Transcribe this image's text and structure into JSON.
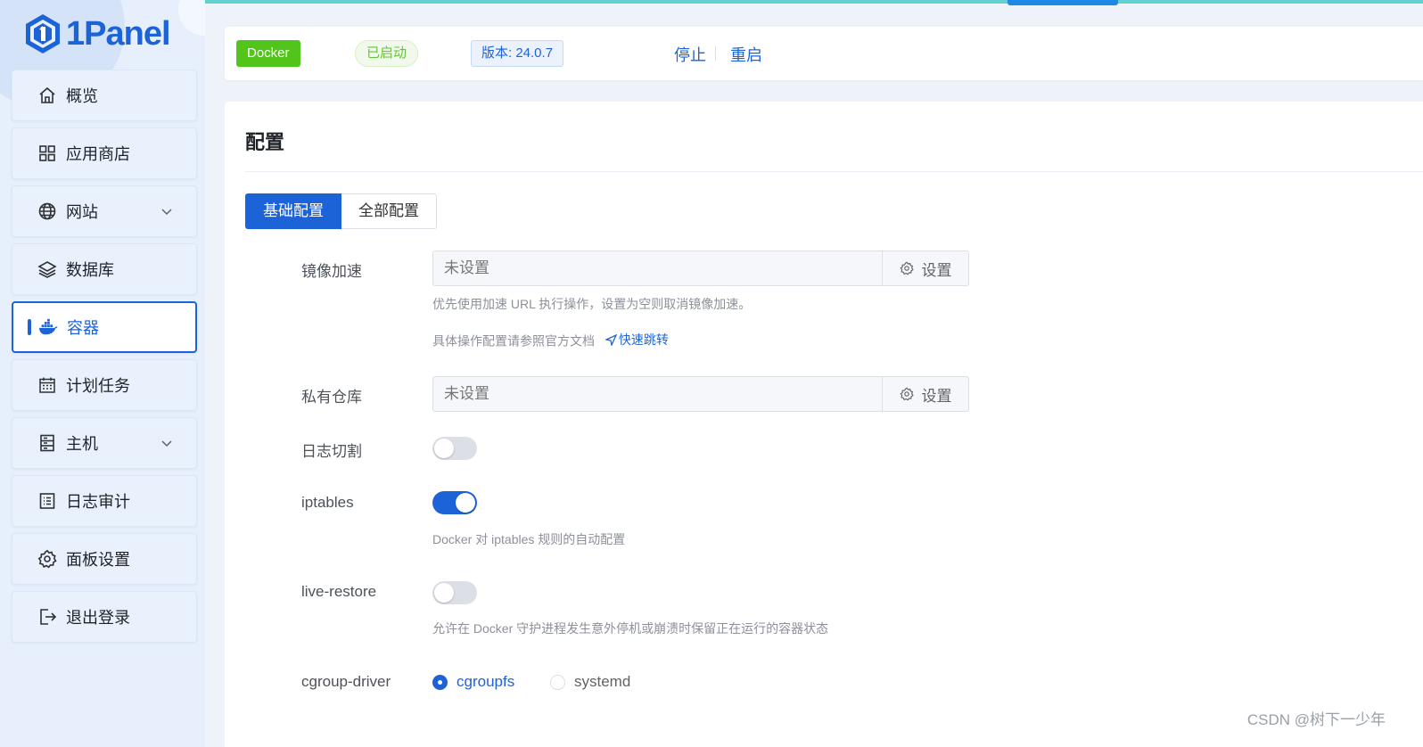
{
  "app": {
    "logo_text": "1Panel"
  },
  "sidebar": {
    "items": [
      {
        "label": "概览",
        "icon": "home-icon"
      },
      {
        "label": "应用商店",
        "icon": "grid-icon"
      },
      {
        "label": "网站",
        "icon": "globe-icon",
        "expandable": true
      },
      {
        "label": "数据库",
        "icon": "layers-icon"
      },
      {
        "label": "容器",
        "icon": "docker-icon",
        "active": true
      },
      {
        "label": "计划任务",
        "icon": "calendar-icon"
      },
      {
        "label": "主机",
        "icon": "server-icon",
        "expandable": true
      },
      {
        "label": "日志审计",
        "icon": "log-icon"
      },
      {
        "label": "面板设置",
        "icon": "gear-icon"
      },
      {
        "label": "退出登录",
        "icon": "logout-icon"
      }
    ]
  },
  "status": {
    "name": "Docker",
    "state": "已启动",
    "version": "版本: 24.0.7",
    "stop_label": "停止",
    "restart_label": "重启"
  },
  "config": {
    "title": "配置",
    "tabs": [
      "基础配置",
      "全部配置"
    ],
    "active_tab": "基础配置",
    "mirror": {
      "label": "镜像加速",
      "placeholder": "未设置",
      "button": "设置",
      "help1": "优先使用加速 URL 执行操作，设置为空则取消镜像加速。",
      "help2": "具体操作配置请参照官方文档",
      "jump_link": "快速跳转"
    },
    "registry": {
      "label": "私有仓库",
      "placeholder": "未设置",
      "button": "设置"
    },
    "log_rotate": {
      "label": "日志切割",
      "enabled": false
    },
    "iptables": {
      "label": "iptables",
      "enabled": true,
      "help": "Docker 对 iptables 规则的自动配置"
    },
    "live_restore": {
      "label": "live-restore",
      "enabled": false,
      "help": "允许在 Docker 守护进程发生意外停机或崩溃时保留正在运行的容器状态"
    },
    "cgroup_driver": {
      "label": "cgroup-driver",
      "options": [
        "cgroupfs",
        "systemd"
      ],
      "selected": "cgroupfs"
    }
  },
  "watermark": "CSDN @树下一少年",
  "colors": {
    "primary": "#1d63d8",
    "success": "#52c41a",
    "topbar": "#5fd2cf"
  }
}
